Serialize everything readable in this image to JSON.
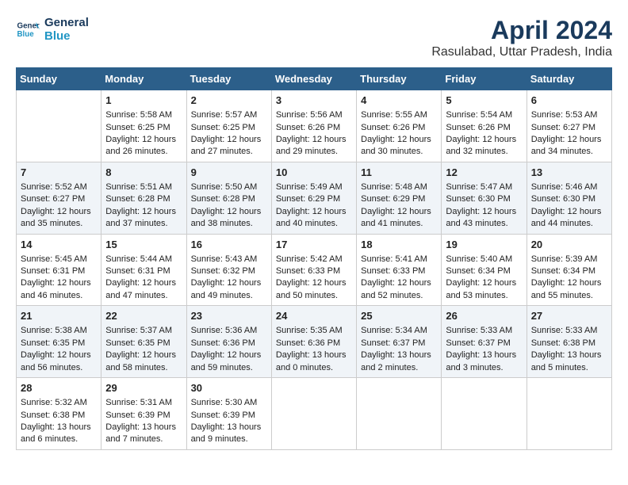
{
  "header": {
    "logo_line1": "General",
    "logo_line2": "Blue",
    "title": "April 2024",
    "subtitle": "Rasulabad, Uttar Pradesh, India"
  },
  "days_of_week": [
    "Sunday",
    "Monday",
    "Tuesday",
    "Wednesday",
    "Thursday",
    "Friday",
    "Saturday"
  ],
  "weeks": [
    [
      {
        "day": "",
        "info": ""
      },
      {
        "day": "1",
        "info": "Sunrise: 5:58 AM\nSunset: 6:25 PM\nDaylight: 12 hours\nand 26 minutes."
      },
      {
        "day": "2",
        "info": "Sunrise: 5:57 AM\nSunset: 6:25 PM\nDaylight: 12 hours\nand 27 minutes."
      },
      {
        "day": "3",
        "info": "Sunrise: 5:56 AM\nSunset: 6:26 PM\nDaylight: 12 hours\nand 29 minutes."
      },
      {
        "day": "4",
        "info": "Sunrise: 5:55 AM\nSunset: 6:26 PM\nDaylight: 12 hours\nand 30 minutes."
      },
      {
        "day": "5",
        "info": "Sunrise: 5:54 AM\nSunset: 6:26 PM\nDaylight: 12 hours\nand 32 minutes."
      },
      {
        "day": "6",
        "info": "Sunrise: 5:53 AM\nSunset: 6:27 PM\nDaylight: 12 hours\nand 34 minutes."
      }
    ],
    [
      {
        "day": "7",
        "info": "Sunrise: 5:52 AM\nSunset: 6:27 PM\nDaylight: 12 hours\nand 35 minutes."
      },
      {
        "day": "8",
        "info": "Sunrise: 5:51 AM\nSunset: 6:28 PM\nDaylight: 12 hours\nand 37 minutes."
      },
      {
        "day": "9",
        "info": "Sunrise: 5:50 AM\nSunset: 6:28 PM\nDaylight: 12 hours\nand 38 minutes."
      },
      {
        "day": "10",
        "info": "Sunrise: 5:49 AM\nSunset: 6:29 PM\nDaylight: 12 hours\nand 40 minutes."
      },
      {
        "day": "11",
        "info": "Sunrise: 5:48 AM\nSunset: 6:29 PM\nDaylight: 12 hours\nand 41 minutes."
      },
      {
        "day": "12",
        "info": "Sunrise: 5:47 AM\nSunset: 6:30 PM\nDaylight: 12 hours\nand 43 minutes."
      },
      {
        "day": "13",
        "info": "Sunrise: 5:46 AM\nSunset: 6:30 PM\nDaylight: 12 hours\nand 44 minutes."
      }
    ],
    [
      {
        "day": "14",
        "info": "Sunrise: 5:45 AM\nSunset: 6:31 PM\nDaylight: 12 hours\nand 46 minutes."
      },
      {
        "day": "15",
        "info": "Sunrise: 5:44 AM\nSunset: 6:31 PM\nDaylight: 12 hours\nand 47 minutes."
      },
      {
        "day": "16",
        "info": "Sunrise: 5:43 AM\nSunset: 6:32 PM\nDaylight: 12 hours\nand 49 minutes."
      },
      {
        "day": "17",
        "info": "Sunrise: 5:42 AM\nSunset: 6:33 PM\nDaylight: 12 hours\nand 50 minutes."
      },
      {
        "day": "18",
        "info": "Sunrise: 5:41 AM\nSunset: 6:33 PM\nDaylight: 12 hours\nand 52 minutes."
      },
      {
        "day": "19",
        "info": "Sunrise: 5:40 AM\nSunset: 6:34 PM\nDaylight: 12 hours\nand 53 minutes."
      },
      {
        "day": "20",
        "info": "Sunrise: 5:39 AM\nSunset: 6:34 PM\nDaylight: 12 hours\nand 55 minutes."
      }
    ],
    [
      {
        "day": "21",
        "info": "Sunrise: 5:38 AM\nSunset: 6:35 PM\nDaylight: 12 hours\nand 56 minutes."
      },
      {
        "day": "22",
        "info": "Sunrise: 5:37 AM\nSunset: 6:35 PM\nDaylight: 12 hours\nand 58 minutes."
      },
      {
        "day": "23",
        "info": "Sunrise: 5:36 AM\nSunset: 6:36 PM\nDaylight: 12 hours\nand 59 minutes."
      },
      {
        "day": "24",
        "info": "Sunrise: 5:35 AM\nSunset: 6:36 PM\nDaylight: 13 hours\nand 0 minutes."
      },
      {
        "day": "25",
        "info": "Sunrise: 5:34 AM\nSunset: 6:37 PM\nDaylight: 13 hours\nand 2 minutes."
      },
      {
        "day": "26",
        "info": "Sunrise: 5:33 AM\nSunset: 6:37 PM\nDaylight: 13 hours\nand 3 minutes."
      },
      {
        "day": "27",
        "info": "Sunrise: 5:33 AM\nSunset: 6:38 PM\nDaylight: 13 hours\nand 5 minutes."
      }
    ],
    [
      {
        "day": "28",
        "info": "Sunrise: 5:32 AM\nSunset: 6:38 PM\nDaylight: 13 hours\nand 6 minutes."
      },
      {
        "day": "29",
        "info": "Sunrise: 5:31 AM\nSunset: 6:39 PM\nDaylight: 13 hours\nand 7 minutes."
      },
      {
        "day": "30",
        "info": "Sunrise: 5:30 AM\nSunset: 6:39 PM\nDaylight: 13 hours\nand 9 minutes."
      },
      {
        "day": "",
        "info": ""
      },
      {
        "day": "",
        "info": ""
      },
      {
        "day": "",
        "info": ""
      },
      {
        "day": "",
        "info": ""
      }
    ]
  ]
}
